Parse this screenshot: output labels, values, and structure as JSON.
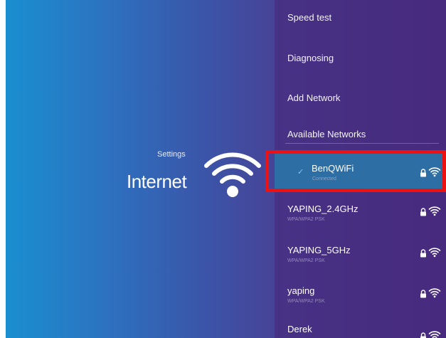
{
  "left": {
    "breadcrumb": "Settings",
    "title": "Internet",
    "icon": "wifi-icon"
  },
  "menu": {
    "speed_test": "Speed test",
    "diagnosing": "Diagnosing",
    "add_network": "Add Network",
    "available_header": "Available Networks"
  },
  "networks": [
    {
      "name": "BenQWiFi",
      "status": "Connected",
      "selected": true,
      "secured": true
    },
    {
      "name": "YAPING_2.4GHz",
      "status": "WPA/WPA2 PSK",
      "selected": false,
      "secured": true
    },
    {
      "name": "YAPING_5GHz",
      "status": "WPA/WPA2 PSK",
      "selected": false,
      "secured": true
    },
    {
      "name": "yaping",
      "status": "WPA/WPA2 PSK",
      "selected": false,
      "secured": true
    },
    {
      "name": "Derek",
      "status": "",
      "selected": false,
      "secured": true
    }
  ],
  "colors": {
    "highlight": "#ee1111",
    "selected_row": "#2d6ea4",
    "check": "#7fc7ef"
  }
}
